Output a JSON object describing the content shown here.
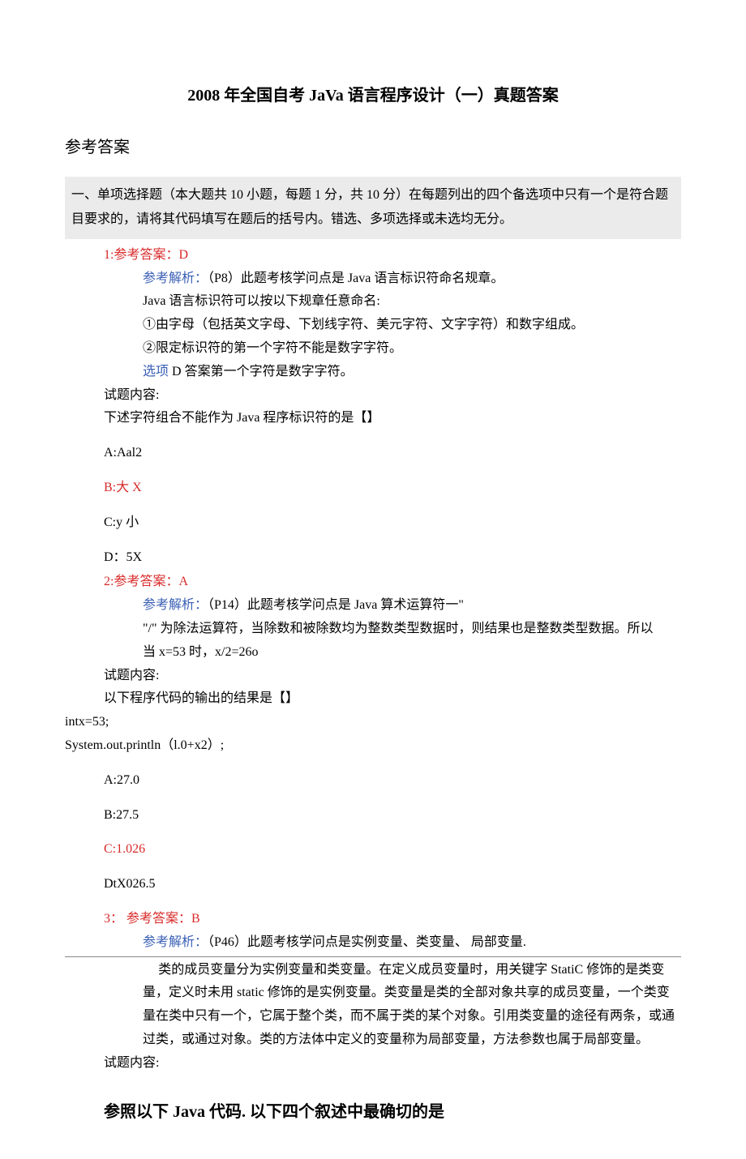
{
  "title": "2008 年全国自考 JaVa 语言程序设计（一）真题答案",
  "section_header": "参考答案",
  "gray_intro": "一、单项选择题（本大题共 10 小题，每题 1 分，共 10 分）在每题列出的四个备选项中只有一个是符合题目要求的，请将其代码填写在题后的括号内。错选、多项选择或未选均无分。",
  "q1": {
    "ans_label": "1:参考答案：D",
    "explain_label": "参考解析：",
    "explain_text": "（P8）此题考核学问点是 Java 语言标识符命名规章。",
    "line2": "Java 语言标识符可以按以下规章任意命名:",
    "line3": "①由字母（包括英文字母、下划线字符、美元字符、文字字符）和数字组成。",
    "line4": "②限定标识符的第一个字符不能是数字字符。",
    "line5_label": "选项",
    "line5_text": " D 答案第一个字符是数字字符。",
    "content_label": "试题内容:",
    "stem": "下述字符组合不能作为 Java 程序标识符的是【】",
    "optA": "A:Aal2",
    "optB": "B:大 X",
    "optC": "C:y 小",
    "optD": "D：5X"
  },
  "q2": {
    "ans_label": "2:参考答案：A",
    "explain_label": "参考解析：",
    "explain_text": "（P14）此题考核学问点是 Java 算术运算符一\"",
    "line2": "\"/\" 为除法运算符，当除数和被除数均为整数类型数据时，则结果也是整数类型数据。所以",
    "line3": "当 x=53 时，x/2=26o",
    "content_label": "试题内容:",
    "stem": "以下程序代码的输出的结果是【】",
    "code1": "intx=53;",
    "code2": "System.out.println（l.0+x2）;",
    "optA": "A:27.0",
    "optB": "B:27.5",
    "optC": "C:1.026",
    "optD": "DtX026.5"
  },
  "q3": {
    "ans_label": "3： 参考答案：B",
    "explain_label": "参考解析：",
    "explain_text": "（P46）此题考核学问点是实例变量、类变量、 局部变量.",
    "para": "类的成员变量分为实例变量和类变量。在定义成员变量时，用关键字 StatiC 修饰的是类变量，定义时未用 static 修饰的是实例变量。类变量是类的全部对象共享的成员变量，一个类变量在类中只有一个，它属于整个类，而不属于类的某个对象。引用类变量的途径有两条，或通过类，或通过对象。类的方法体中定义的变量称为局部变量，方法参数也属于局部变量。",
    "content_label": "试题内容:",
    "heading": "参照以下 Java 代码. 以下四个叙述中最确切的是"
  }
}
